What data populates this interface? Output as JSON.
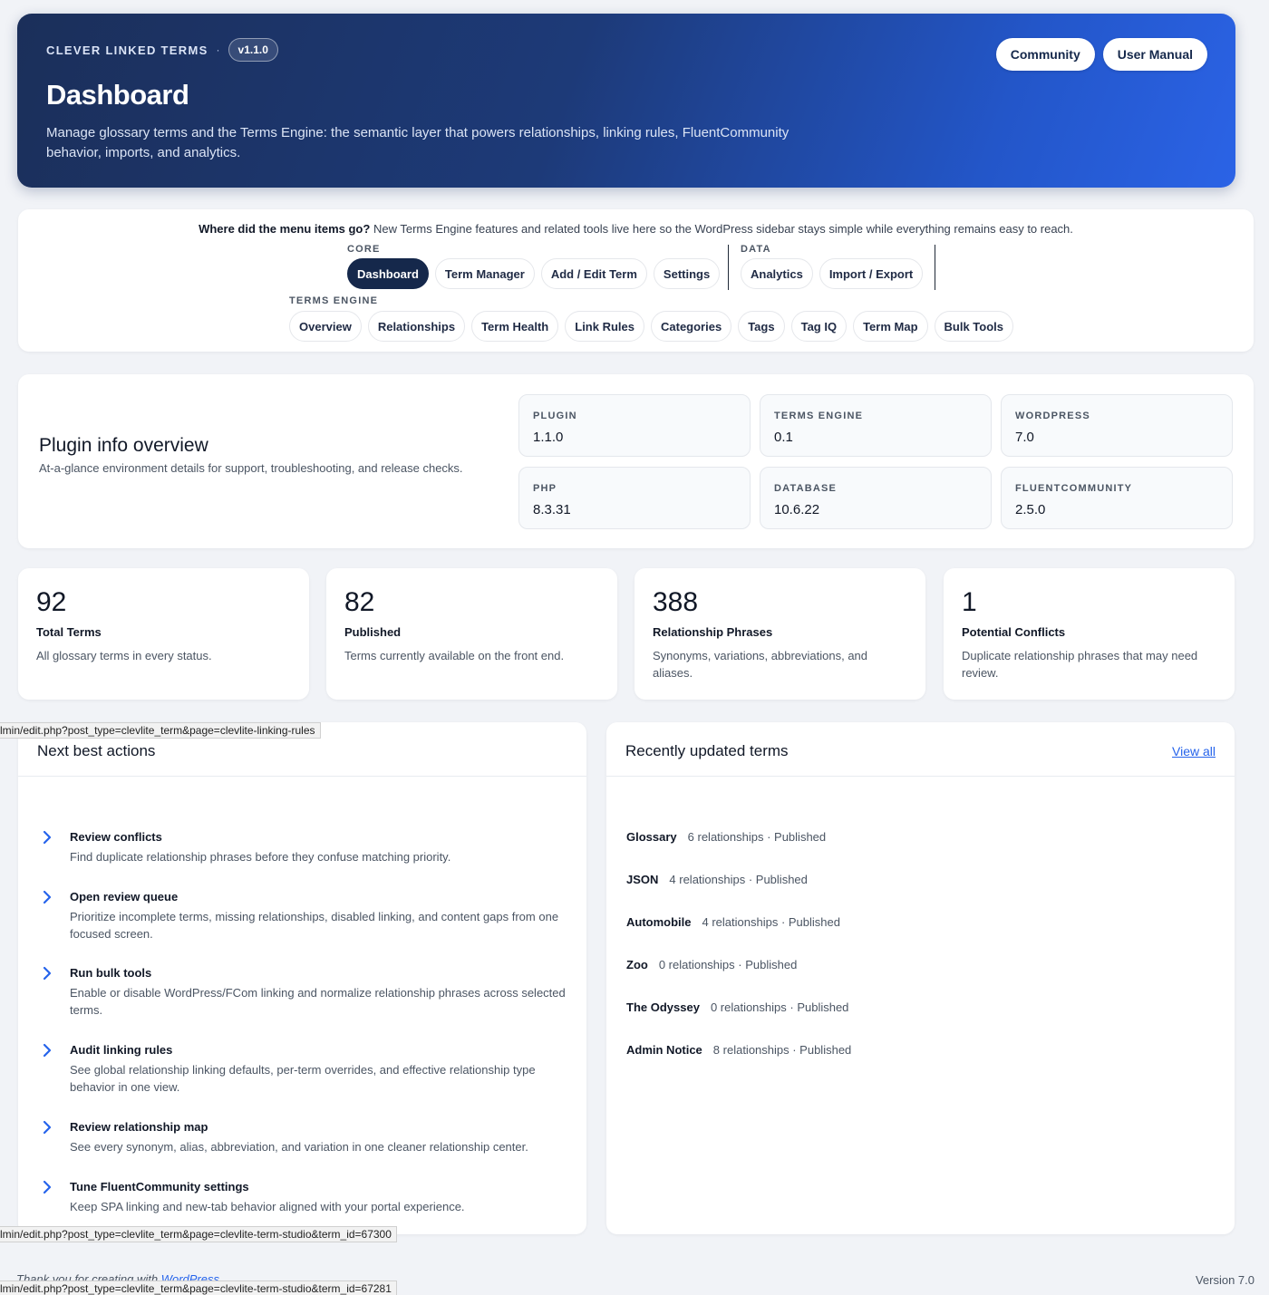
{
  "hero": {
    "brand": "CLEVER LINKED TERMS",
    "separator": "·",
    "version": "v1.1.0",
    "title": "Dashboard",
    "description": "Manage glossary terms and the Terms Engine: the semantic layer that powers relationships, linking rules, FluentCommunity behavior, imports, and analytics.",
    "buttons": [
      "Community",
      "User Manual"
    ]
  },
  "nav": {
    "note_bold": "Where did the menu items go?",
    "note": "New Terms Engine features and related tools live here so the WordPress sidebar stays simple while everything remains easy to reach.",
    "groups": {
      "core": {
        "label": "CORE",
        "items": [
          "Dashboard",
          "Term Manager",
          "Add / Edit Term",
          "Settings"
        ]
      },
      "data": {
        "label": "DATA",
        "items": [
          "Analytics",
          "Import / Export"
        ]
      },
      "engine": {
        "label": "TERMS ENGINE",
        "items": [
          "Overview",
          "Relationships",
          "Term Health",
          "Link Rules",
          "Categories",
          "Tags",
          "Tag IQ",
          "Term Map",
          "Bulk Tools"
        ]
      }
    },
    "active": "Dashboard"
  },
  "plugin_info": {
    "title": "Plugin info overview",
    "subtitle": "At-a-glance environment details for support, troubleshooting, and release checks.",
    "items": [
      {
        "key": "PLUGIN",
        "value": "1.1.0"
      },
      {
        "key": "TERMS ENGINE",
        "value": "0.1"
      },
      {
        "key": "WORDPRESS",
        "value": "7.0"
      },
      {
        "key": "PHP",
        "value": "8.3.31"
      },
      {
        "key": "DATABASE",
        "value": "10.6.22"
      },
      {
        "key": "FLUENTCOMMUNITY",
        "value": "2.5.0"
      }
    ]
  },
  "stats": [
    {
      "number": "92",
      "label": "Total Terms",
      "desc": "All glossary terms in every status."
    },
    {
      "number": "82",
      "label": "Published",
      "desc": "Terms currently available on the front end."
    },
    {
      "number": "388",
      "label": "Relationship Phrases",
      "desc": "Synonyms, variations, abbreviations, and aliases."
    },
    {
      "number": "1",
      "label": "Potential Conflicts",
      "desc": "Duplicate relationship phrases that may need review."
    }
  ],
  "actions": {
    "title": "Next best actions",
    "items": [
      {
        "title": "Review conflicts",
        "desc": "Find duplicate relationship phrases before they confuse matching priority."
      },
      {
        "title": "Open review queue",
        "desc": "Prioritize incomplete terms, missing relationships, disabled linking, and content gaps from one focused screen."
      },
      {
        "title": "Run bulk tools",
        "desc": "Enable or disable WordPress/FCom linking and normalize relationship phrases across selected terms."
      },
      {
        "title": "Audit linking rules",
        "desc": "See global relationship linking defaults, per-term overrides, and effective relationship type behavior in one view."
      },
      {
        "title": "Review relationship map",
        "desc": "See every synonym, alias, abbreviation, and variation in one cleaner relationship center."
      },
      {
        "title": "Tune FluentCommunity settings",
        "desc": "Keep SPA linking and new-tab behavior aligned with your portal experience."
      }
    ]
  },
  "recent": {
    "title": "Recently updated terms",
    "view_all": "View all",
    "items": [
      {
        "name": "Glossary",
        "meta": "6 relationships · Published"
      },
      {
        "name": "JSON",
        "meta": "4 relationships · Published"
      },
      {
        "name": "Automobile",
        "meta": "4 relationships · Published"
      },
      {
        "name": "Zoo",
        "meta": "0 relationships · Published"
      },
      {
        "name": "The Odyssey",
        "meta": "0 relationships · Published"
      },
      {
        "name": "Admin Notice",
        "meta": "8 relationships · Published"
      }
    ]
  },
  "status_urls": [
    "lmin/edit.php?post_type=clevlite_term&page=clevlite-linking-rules",
    "lmin/edit.php?post_type=clevlite_term&page=clevlite-term-studio&term_id=67300",
    "lmin/edit.php?post_type=clevlite_term&page=clevlite-term-studio&term_id=67281"
  ],
  "footer": {
    "left_text": "Thank you for creating with",
    "left_link": "WordPress",
    "version": "Version 7.0"
  },
  "colors": {
    "hero_start": "#1b2f5a",
    "hero_end": "#2b63e6",
    "active_tab": "#15284b",
    "link": "#2563eb",
    "chevron": "#2563eb"
  }
}
